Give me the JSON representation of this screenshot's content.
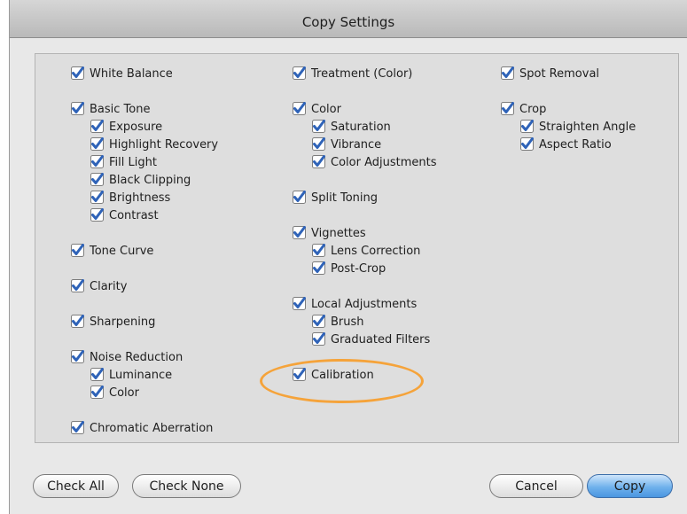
{
  "window": {
    "title": "Copy Settings"
  },
  "columns": [
    [
      {
        "label": "White Balance",
        "checked": true,
        "level": 0
      },
      {
        "label": "Basic Tone",
        "checked": true,
        "level": 0
      },
      {
        "label": "Exposure",
        "checked": true,
        "level": 1
      },
      {
        "label": "Highlight Recovery",
        "checked": true,
        "level": 1
      },
      {
        "label": "Fill Light",
        "checked": true,
        "level": 1
      },
      {
        "label": "Black Clipping",
        "checked": true,
        "level": 1
      },
      {
        "label": "Brightness",
        "checked": true,
        "level": 1
      },
      {
        "label": "Contrast",
        "checked": true,
        "level": 1
      },
      {
        "label": "Tone Curve",
        "checked": true,
        "level": 0
      },
      {
        "label": "Clarity",
        "checked": true,
        "level": 0
      },
      {
        "label": "Sharpening",
        "checked": true,
        "level": 0
      },
      {
        "label": "Noise Reduction",
        "checked": true,
        "level": 0
      },
      {
        "label": "Luminance",
        "checked": true,
        "level": 1
      },
      {
        "label": "Color",
        "checked": true,
        "level": 1
      },
      {
        "label": "Chromatic Aberration",
        "checked": true,
        "level": 0
      }
    ],
    [
      {
        "label": "Treatment (Color)",
        "checked": true,
        "level": 0
      },
      {
        "label": "Color",
        "checked": true,
        "level": 0
      },
      {
        "label": "Saturation",
        "checked": true,
        "level": 1
      },
      {
        "label": "Vibrance",
        "checked": true,
        "level": 1
      },
      {
        "label": "Color Adjustments",
        "checked": true,
        "level": 1
      },
      {
        "label": "Split Toning",
        "checked": true,
        "level": 0
      },
      {
        "label": "Vignettes",
        "checked": true,
        "level": 0
      },
      {
        "label": "Lens Correction",
        "checked": true,
        "level": 1
      },
      {
        "label": "Post-Crop",
        "checked": true,
        "level": 1
      },
      {
        "label": "Local Adjustments",
        "checked": true,
        "level": 0
      },
      {
        "label": "Brush",
        "checked": true,
        "level": 1
      },
      {
        "label": "Graduated Filters",
        "checked": true,
        "level": 1
      },
      {
        "label": "Calibration",
        "checked": true,
        "level": 0,
        "highlighted": true
      }
    ],
    [
      {
        "label": "Spot Removal",
        "checked": true,
        "level": 0
      },
      {
        "label": "Crop",
        "checked": true,
        "level": 0
      },
      {
        "label": "Straighten Angle",
        "checked": true,
        "level": 1
      },
      {
        "label": "Aspect Ratio",
        "checked": true,
        "level": 1
      }
    ]
  ],
  "buttons": {
    "check_all": "Check All",
    "check_none": "Check None",
    "cancel": "Cancel",
    "copy": "Copy"
  },
  "colors": {
    "checkbox": "#2f63b8",
    "highlight": "#f5a33a",
    "primary_button": "#5aa3e6"
  }
}
